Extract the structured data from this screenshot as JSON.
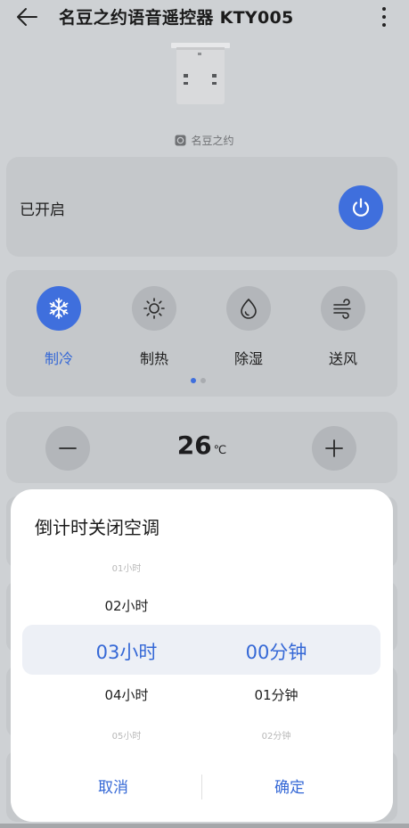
{
  "header": {
    "title": "名豆之约语音遥控器 KTY005",
    "back_icon": "arrow-left-icon",
    "more_icon": "more-vertical-icon"
  },
  "device": {
    "image": "usb-dongle-image",
    "brand_logo": "brand-logo-icon",
    "brand": "名豆之约"
  },
  "power": {
    "label": "已开启",
    "state": "on",
    "icon": "power-icon"
  },
  "modes": [
    {
      "label": "制冷",
      "icon": "snowflake-icon",
      "active": true
    },
    {
      "label": "制热",
      "icon": "sun-icon",
      "active": false
    },
    {
      "label": "除湿",
      "icon": "droplet-icon",
      "active": false
    },
    {
      "label": "送风",
      "icon": "wind-icon",
      "active": false
    }
  ],
  "mode_pages": {
    "count": 2,
    "current": 1
  },
  "temperature": {
    "value": "26",
    "unit": "℃",
    "decrease_icon": "minus-icon",
    "increase_icon": "plus-icon"
  },
  "timer_sheet": {
    "title": "倒计时关闭空调",
    "hours": [
      "01小时",
      "02小时",
      "03小时",
      "04小时",
      "05小时"
    ],
    "hours_selected": "03小时",
    "minutes": [
      "00分钟",
      "01分钟",
      "02分钟"
    ],
    "minutes_selected": "00分钟",
    "cancel_label": "取消",
    "confirm_label": "确定"
  },
  "colors": {
    "accent": "#3f6fdd",
    "accent_text": "#3568d6",
    "dimmed_background": "#ced1d4",
    "card": "#c5c8cb",
    "sheet": "#ffffff",
    "picker_highlight": "#edf0f6"
  }
}
